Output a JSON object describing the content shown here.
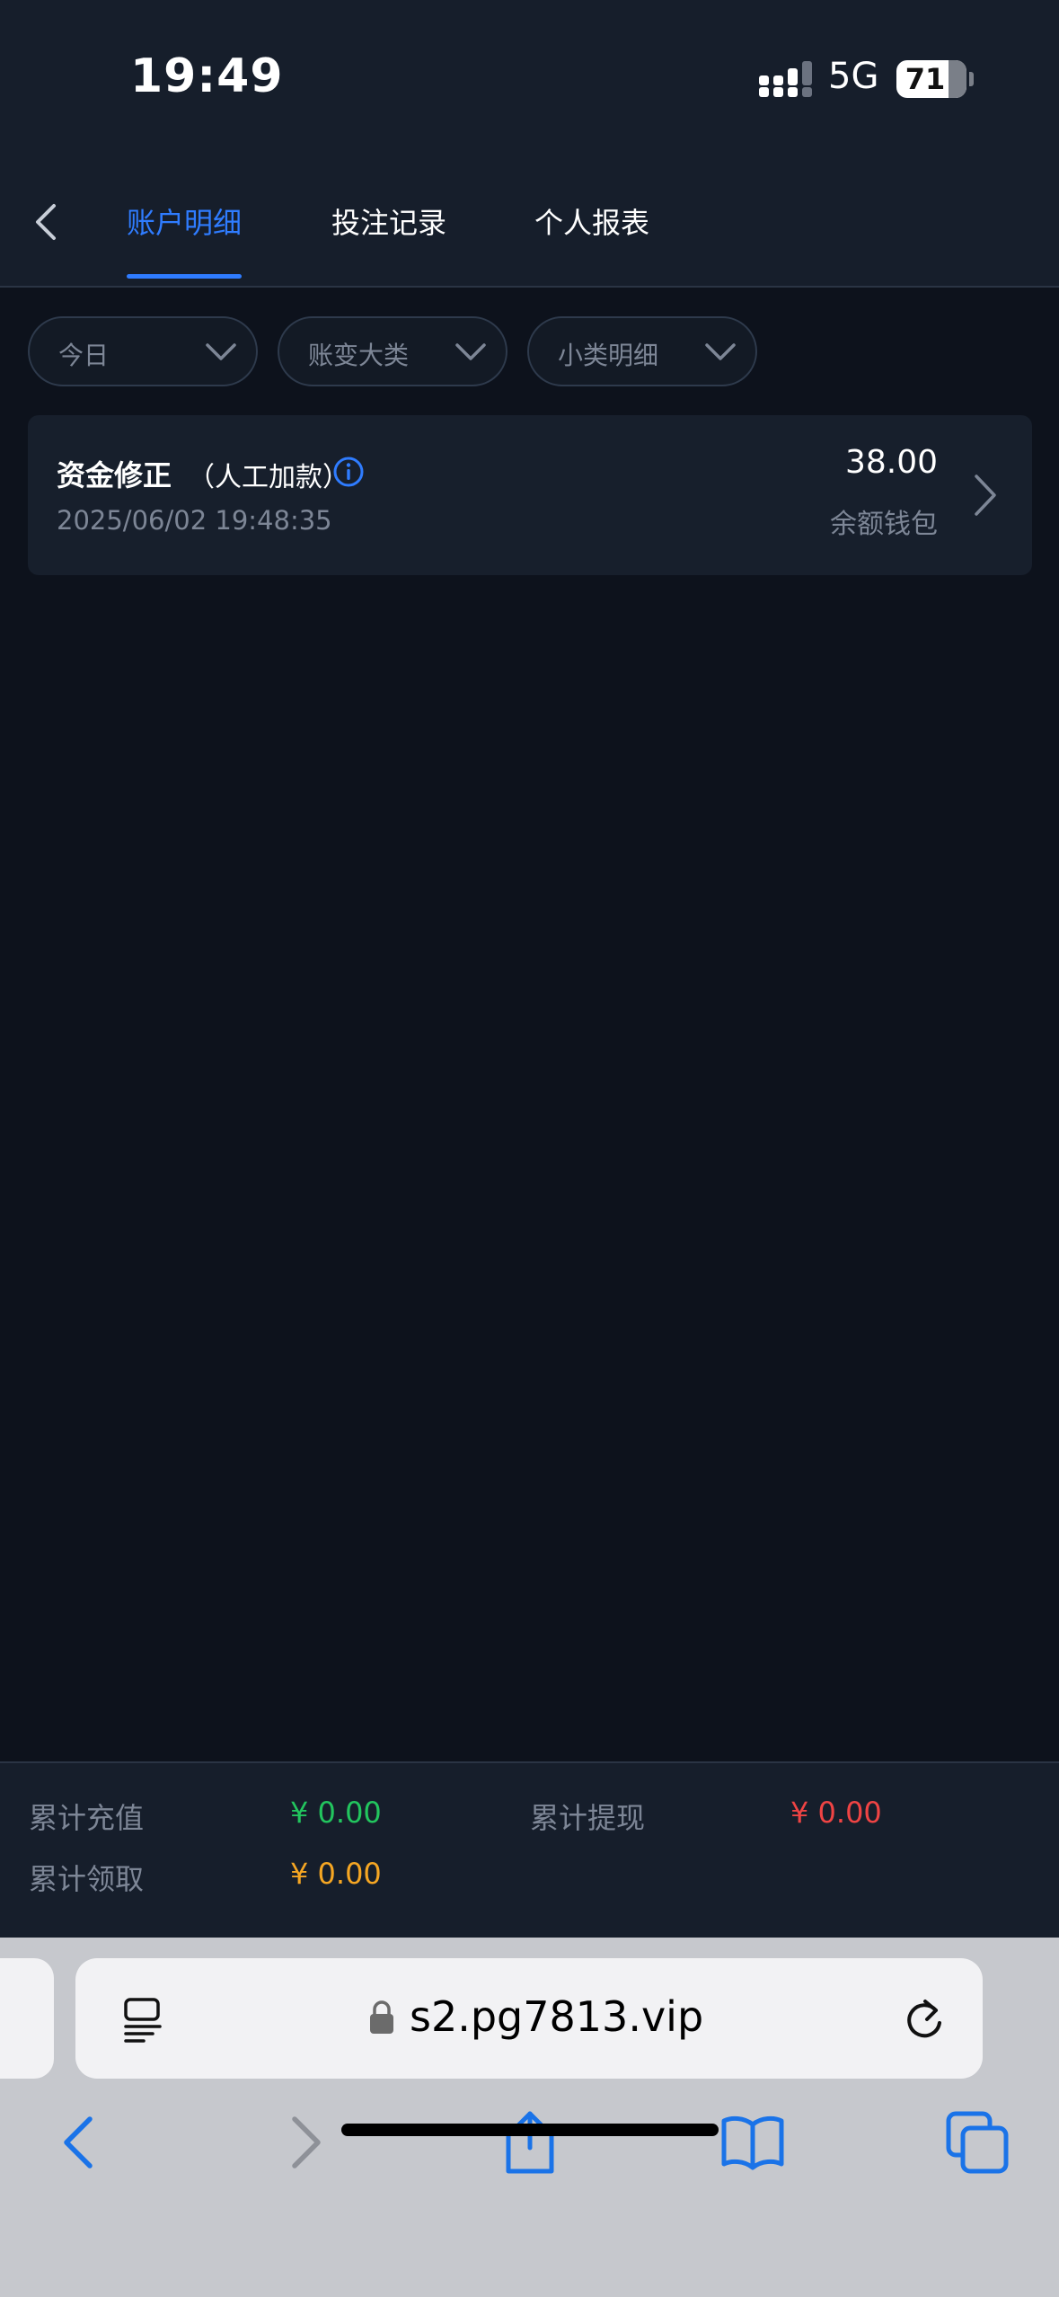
{
  "status_bar": {
    "time": "19:49",
    "network": "5G",
    "battery": "71"
  },
  "nav": {
    "tabs": [
      {
        "label": "账户明细",
        "active": true
      },
      {
        "label": "投注记录",
        "active": false
      },
      {
        "label": "个人报表",
        "active": false
      }
    ]
  },
  "filters": [
    {
      "label": "今日"
    },
    {
      "label": "账变大类"
    },
    {
      "label": "小类明细"
    }
  ],
  "records": [
    {
      "title": "资金修正",
      "subtitle": "（人工加款）",
      "time": "2025/06/02 19:48:35",
      "amount": "38.00",
      "wallet": "余额钱包"
    }
  ],
  "summary": {
    "total_recharge_label": "累计充值",
    "total_recharge_value": "¥ 0.00",
    "total_withdraw_label": "累计提现",
    "total_withdraw_value": "¥ 0.00",
    "total_claim_label": "累计领取",
    "total_claim_value": "¥ 0.00"
  },
  "browser": {
    "url": "s2.pg7813.vip"
  },
  "colors": {
    "accent": "#2f7cff",
    "recharge": "#22c55e",
    "withdraw": "#ef4444",
    "claim": "#f5a623",
    "page_bg": "#0d121c",
    "card_bg": "#171f2c"
  },
  "icons": [
    "back-icon",
    "info-icon",
    "chevron-down-icon",
    "chevron-right-icon",
    "reader-icon",
    "lock-icon",
    "reload-icon",
    "back-arrow-icon",
    "forward-arrow-icon",
    "share-icon",
    "bookmarks-icon",
    "tabs-icon"
  ]
}
